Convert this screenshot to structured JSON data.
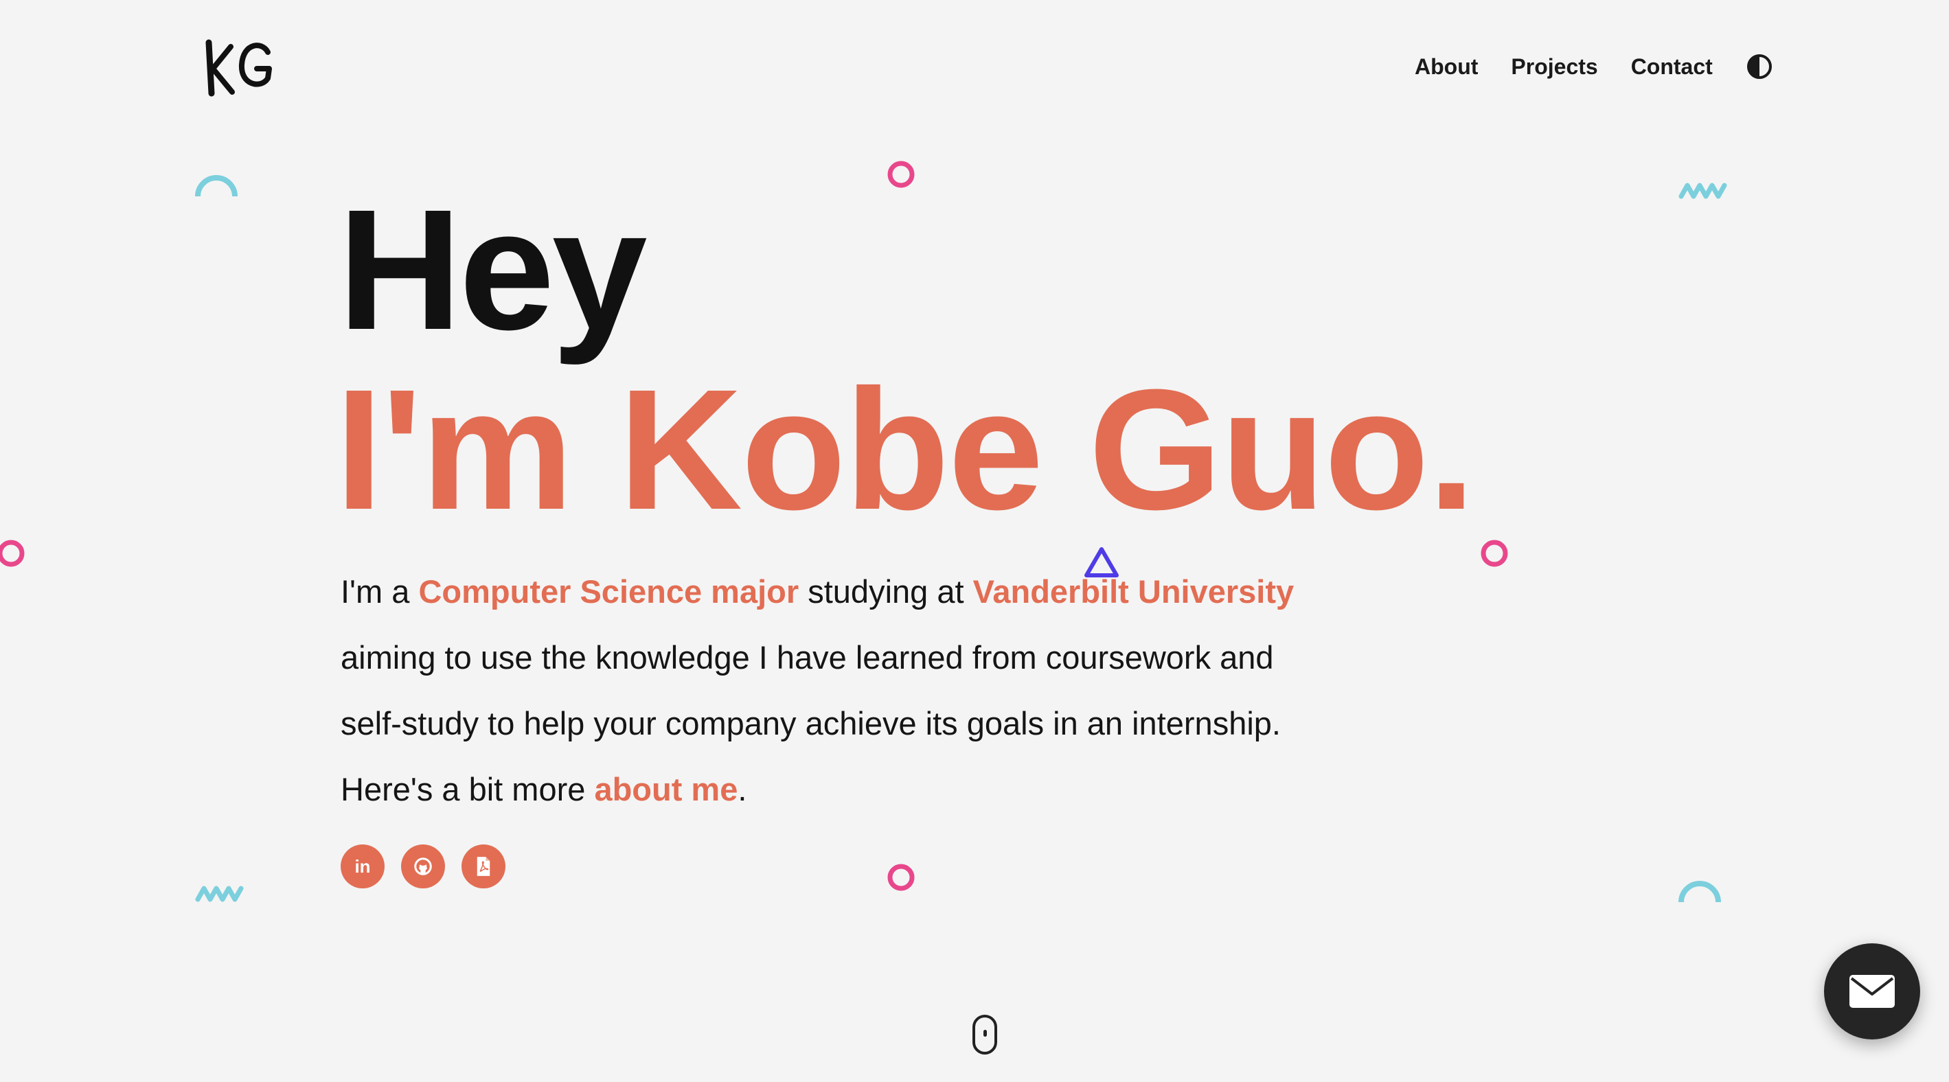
{
  "header": {
    "logo_text": "KG",
    "nav": [
      {
        "label": "About"
      },
      {
        "label": "Projects"
      },
      {
        "label": "Contact"
      }
    ],
    "theme_toggle_icon": "contrast-icon"
  },
  "hero": {
    "greeting": "Hey",
    "name_line": "I'm Kobe Guo.",
    "intro": {
      "p1": "I'm a ",
      "major": "Computer Science major",
      "p2": " studying at ",
      "school": "Vanderbilt University",
      "line2": "aiming to use the knowledge I have learned from coursework and",
      "line3": "self-study to help your company achieve its goals in an internship.",
      "p4": "Here's a bit more ",
      "about_link": "about me",
      "p5": "."
    },
    "socials": [
      {
        "icon": "linkedin-icon",
        "glyph": "in"
      },
      {
        "icon": "github-icon"
      },
      {
        "icon": "pdf-resume-icon"
      }
    ]
  },
  "colors": {
    "accent": "#e26d53",
    "background": "#f4f4f4",
    "decor_pink": "#e8478b",
    "decor_teal": "#7ccfdd",
    "decor_purple": "#4f3ce6",
    "fab": "#252525"
  },
  "floating": {
    "mail_button_icon": "envelope-icon",
    "scroll_indicator_icon": "mouse-scroll-icon"
  }
}
